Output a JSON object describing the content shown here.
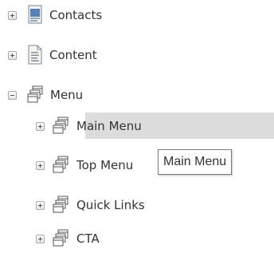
{
  "tree": {
    "items": [
      {
        "label": "Contacts",
        "icon": "contacts-page-icon",
        "expanded": false
      },
      {
        "label": "Content",
        "icon": "content-page-icon",
        "expanded": false
      },
      {
        "label": "Menu",
        "icon": "menu-icon",
        "expanded": true,
        "children": [
          {
            "label": "Main Menu",
            "icon": "menu-icon",
            "expanded": false,
            "hovered": true
          },
          {
            "label": "Top Menu",
            "icon": "menu-icon",
            "expanded": false
          },
          {
            "label": "Quick Links",
            "icon": "menu-icon",
            "expanded": false
          },
          {
            "label": "CTA",
            "icon": "menu-icon",
            "expanded": false
          }
        ]
      }
    ]
  },
  "tooltip": {
    "text": "Main Menu"
  },
  "colors": {
    "hover_highlight": "#dcdcdc",
    "text": "#333333"
  }
}
